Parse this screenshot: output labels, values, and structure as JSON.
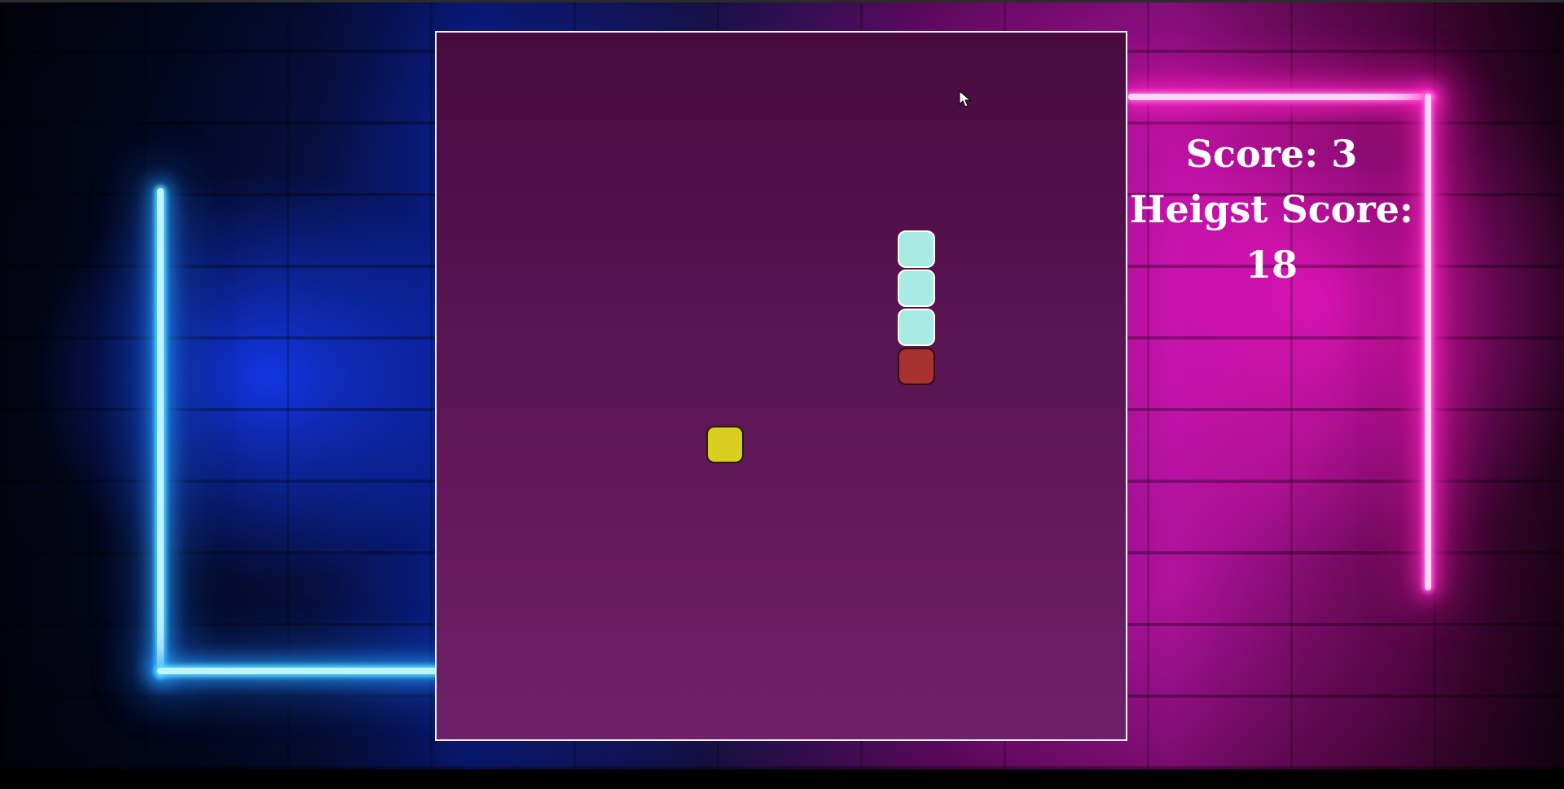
{
  "scoreboard": {
    "score_label": "Score: 3",
    "high_score_label": "Heigst Score: 18"
  },
  "colors": {
    "board_top": "#470b40",
    "board_bottom": "#6e2168",
    "snake_body": "#a8ebe4",
    "snake_head": "#a7322f",
    "food": "#d8cf1f",
    "neon_blue": "#58d8ff",
    "neon_pink": "#ff5ad6"
  },
  "icons": {
    "cursor": "arrow-cursor-icon"
  }
}
